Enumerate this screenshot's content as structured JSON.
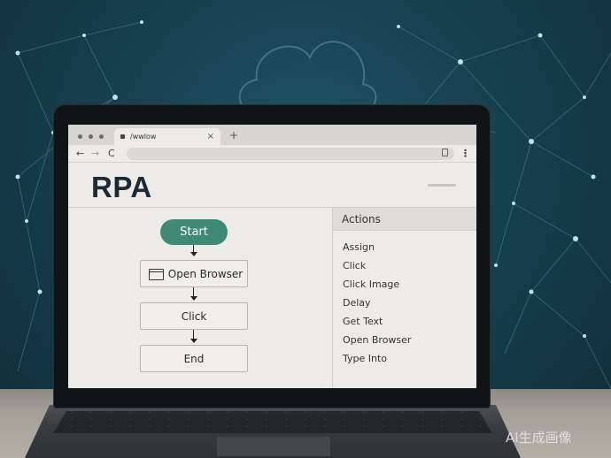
{
  "browser": {
    "tab_title": "/wwlow",
    "tab_close": "×",
    "new_tab": "+",
    "back": "←",
    "forward": "→",
    "reload": "C",
    "menu": "⋮"
  },
  "app": {
    "title": "RPA"
  },
  "flow": {
    "start": "Start",
    "steps": [
      "Open Browser",
      "Click",
      "End"
    ],
    "step_icon": "browser-window-icon",
    "accent_color": "#3f8a74"
  },
  "actions_panel": {
    "header": "Actions",
    "items": [
      "Assign",
      "Click",
      "Click Image",
      "Delay",
      "Get Text",
      "Open Browser",
      "Type Into"
    ]
  },
  "watermark": "AI生成画像"
}
